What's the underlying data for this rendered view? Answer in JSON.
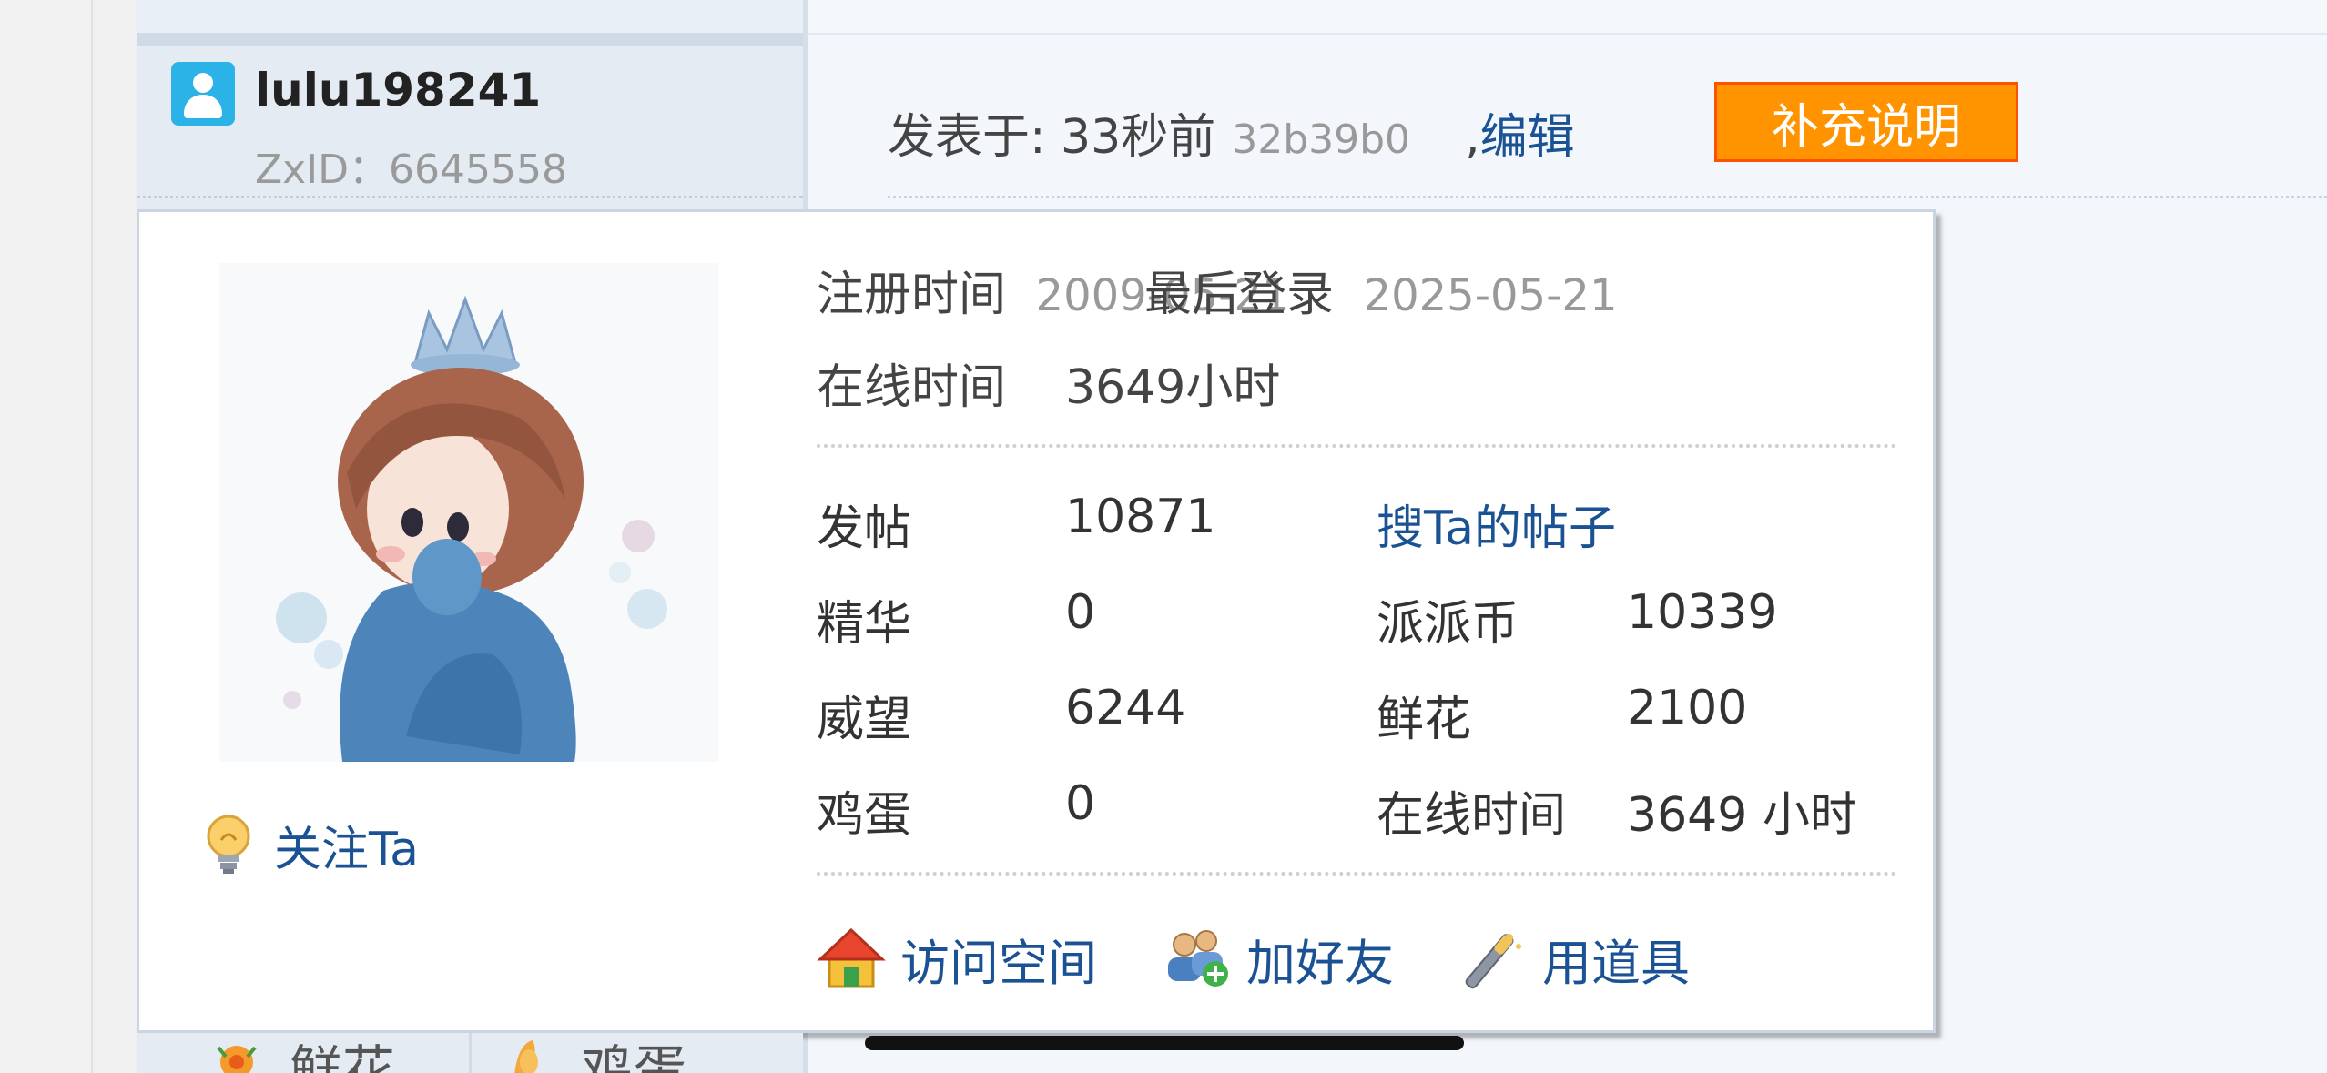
{
  "post_header": {
    "username": "lulu198241",
    "zxid": "ZxID：6645558",
    "posted_label": "发表于: 33秒前",
    "hash": "32b39b0",
    "comma": ",",
    "edit_label": "编辑",
    "supplement_button": "补充说明"
  },
  "popup": {
    "follow_label": "关注Ta",
    "register_label": "注册时间",
    "register_date": "2009-05-21",
    "last_login_label": "最后登录",
    "last_login_date": "2025-05-21",
    "online_label": "在线时间",
    "online_value": "3649小时",
    "stats": {
      "posts_label": "发帖",
      "posts_value": "10871",
      "search_posts_link": "搜Ta的帖子",
      "essence_label": "精华",
      "essence_value": "0",
      "coins_label": "派派币",
      "coins_value": "10339",
      "prestige_label": "威望",
      "prestige_value": "6244",
      "flowers_label": "鲜花",
      "flowers_value": "2100",
      "eggs_label": "鸡蛋",
      "eggs_value": "0",
      "online2_label": "在线时间",
      "online2_value": "3649 小时"
    },
    "actions": {
      "visit_space": "访问空间",
      "add_friend": "加好友",
      "use_item": "用道具"
    }
  },
  "below": {
    "flowers": "鲜花",
    "eggs": "鸡蛋"
  },
  "colors": {
    "link": "#1a5293",
    "button_bg": "#ff9400",
    "button_border": "#ff5200"
  },
  "icons": [
    "user-icon",
    "lightbulb-icon",
    "home-icon",
    "add-friend-icon",
    "magic-wand-icon",
    "flower-icon",
    "egg-icon"
  ]
}
